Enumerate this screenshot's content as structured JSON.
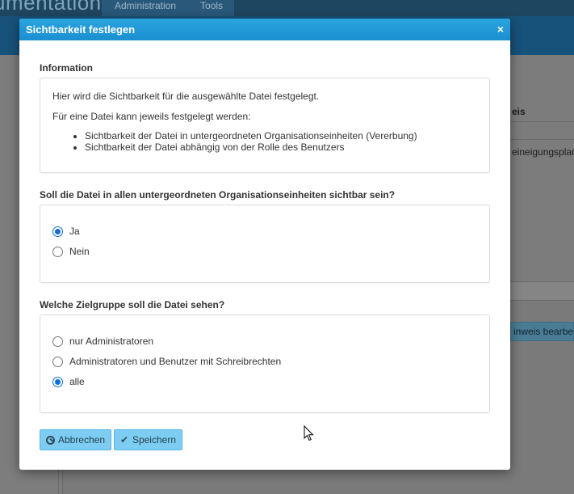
{
  "background": {
    "brand_text": "umentation",
    "tabs": [
      "Administration",
      "Tools"
    ],
    "column_header": "eis",
    "cell_text": "eineigungsplan",
    "button_text": "inweis bearbeit"
  },
  "modal": {
    "title": "Sichtbarkeit festlegen",
    "close_symbol": "×",
    "information": {
      "heading": "Information",
      "line1": "Hier wird die Sichtbarkeit für die ausgewählte Datei festgelegt.",
      "line2": "Für eine Datei kann jeweils festgelegt werden:",
      "bullets": [
        "Sichtbarkeit der Datei in untergeordneten Organisationseinheiten (Vererbung)",
        "Sichtbarkeit der Datei abhängig von der Rolle des Benutzers"
      ]
    },
    "inheritance": {
      "question": "Soll die Datei in allen untergeordneten Organisationseinheiten sichtbar sein?",
      "options": [
        {
          "label": "Ja",
          "checked": true
        },
        {
          "label": "Nein",
          "checked": false
        }
      ]
    },
    "audience": {
      "question": "Welche Zielgruppe soll die Datei sehen?",
      "options": [
        {
          "label": "nur Administratoren",
          "checked": false
        },
        {
          "label": "Administratoren und Benutzer mit Schreibrechten",
          "checked": false
        },
        {
          "label": "alle",
          "checked": true
        }
      ]
    },
    "buttons": {
      "cancel": "Abbrechen",
      "save": "Speichern"
    }
  },
  "colors": {
    "header": "#1a8fd0",
    "button": "#7dcdf3",
    "radio_checked": "#0b6fe0"
  }
}
